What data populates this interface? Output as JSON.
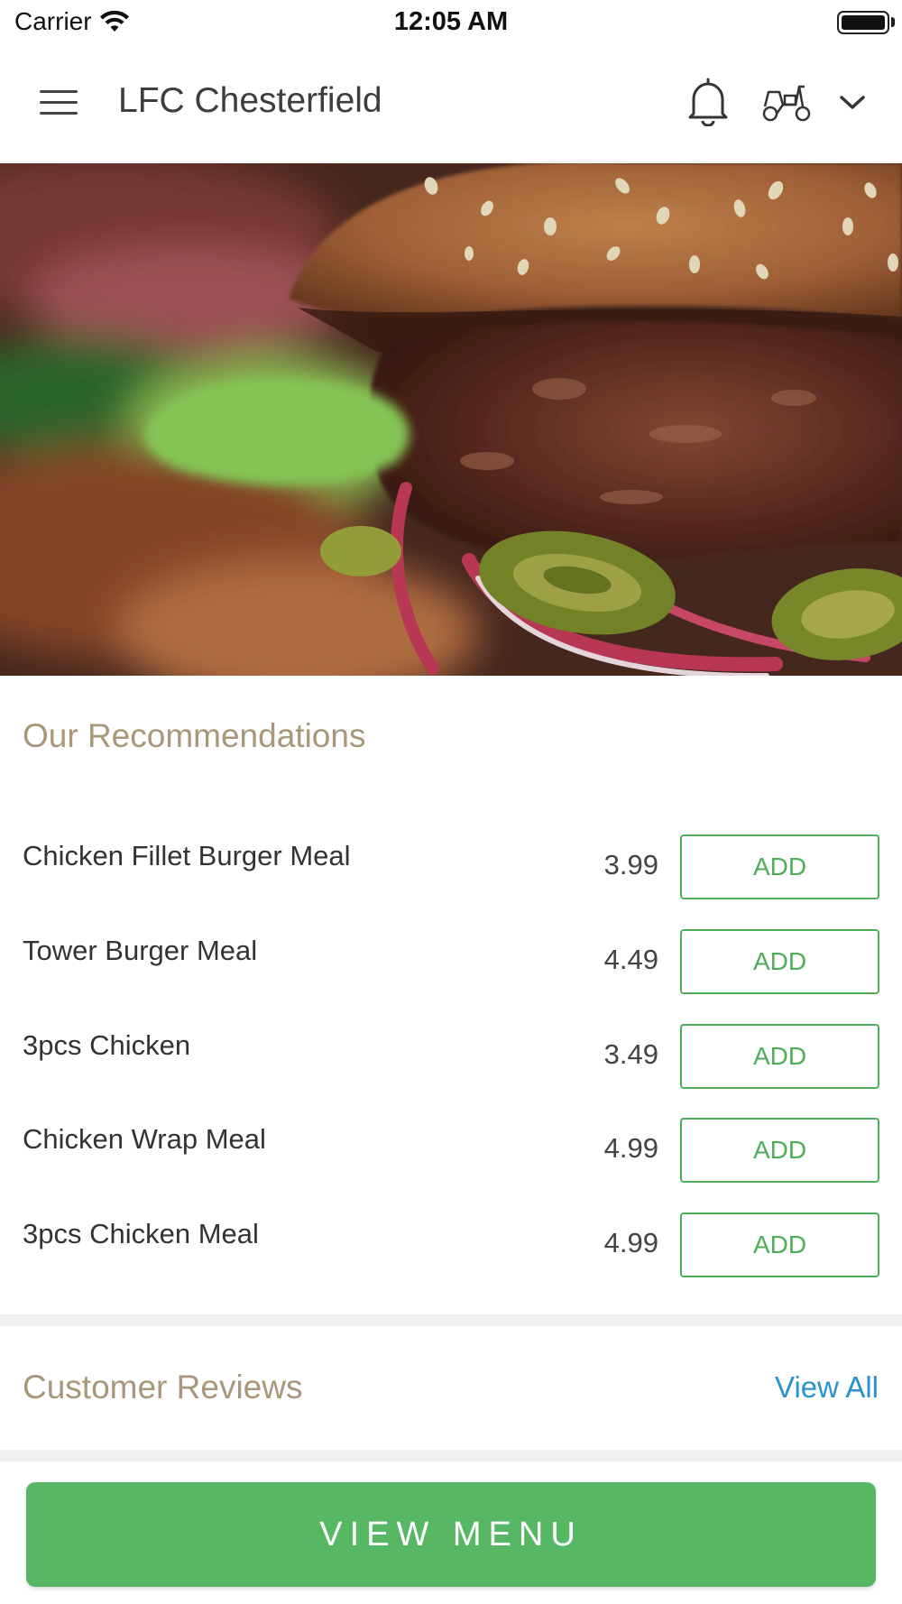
{
  "status_bar": {
    "carrier": "Carrier",
    "time": "12:05 AM",
    "wifi_icon": "wifi-icon",
    "battery_icon": "battery-icon",
    "battery_level": 1.0
  },
  "header": {
    "title": "LFC Chesterfield",
    "icons": [
      "menu-icon",
      "bell-icon",
      "scooter-icon",
      "chevron-down-icon"
    ]
  },
  "hero": {
    "image": "burger-photo"
  },
  "recommendations": {
    "title": "Our Recommendations",
    "items": [
      {
        "name": "Chicken Fillet Burger Meal",
        "price": "3.99",
        "button": "ADD"
      },
      {
        "name": "Tower Burger Meal",
        "price": "4.49",
        "button": "ADD"
      },
      {
        "name": "3pcs Chicken",
        "price": "3.49",
        "button": "ADD"
      },
      {
        "name": "Chicken Wrap Meal",
        "price": "4.99",
        "button": "ADD"
      },
      {
        "name": "3pcs Chicken Meal",
        "price": "4.99",
        "button": "ADD"
      }
    ]
  },
  "reviews": {
    "title": "Customer Reviews",
    "view_all": "View All"
  },
  "footer": {
    "view_menu": "VIEW MENU"
  },
  "colors": {
    "accent_green": "#58b765",
    "add_green": "#4fae58",
    "heading_tan": "#a8977b",
    "link_blue": "#2a93c9"
  }
}
